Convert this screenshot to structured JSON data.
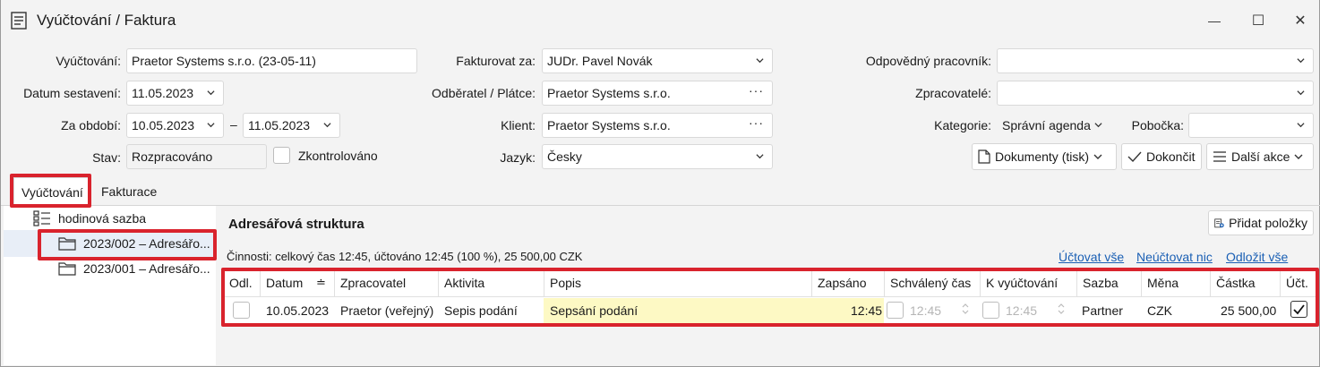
{
  "window": {
    "title": "Vyúčtování / Faktura",
    "minimize_glyph": "—",
    "maximize_glyph": "☐",
    "close_glyph": "✕"
  },
  "form": {
    "vyuctovani": {
      "label": "Vyúčtování:",
      "value": "Praetor Systems s.r.o. (23-05-11)"
    },
    "datum_sestaveni": {
      "label": "Datum sestavení:",
      "value": "11.05.2023"
    },
    "za_obdobi": {
      "label": "Za období:",
      "from": "10.05.2023",
      "dash": "–",
      "to": "11.05.2023"
    },
    "stav": {
      "label": "Stav:",
      "value": "Rozpracováno"
    },
    "zkontrolovano": {
      "label": "Zkontrolováno",
      "checked": false
    },
    "fakturovat_za": {
      "label": "Fakturovat za:",
      "value": "JUDr. Pavel Novák"
    },
    "odberatel": {
      "label": "Odběratel / Plátce:",
      "value": "Praetor Systems s.r.o.",
      "dots": "···"
    },
    "klient": {
      "label": "Klient:",
      "value": "Praetor Systems s.r.o.",
      "dots": "···"
    },
    "jazyk": {
      "label": "Jazyk:",
      "value": "Česky"
    },
    "odpovedny": {
      "label": "Odpovědný pracovník:",
      "value": ""
    },
    "zpracovatele": {
      "label": "Zpracovatelé:",
      "value": ""
    },
    "kategorie": {
      "label": "Kategorie:",
      "value": "Správní agenda"
    },
    "pobocka": {
      "label": "Pobočka:",
      "value": ""
    }
  },
  "buttons": {
    "dokumenty": "Dokumenty (tisk)",
    "dokoncit": "Dokončit",
    "dalsi_akce": "Další akce",
    "pridat_polozky": "Přidat položky"
  },
  "tabs": [
    {
      "label": "Vyúčtování",
      "active": true
    },
    {
      "label": "Fakturace",
      "active": false
    }
  ],
  "tree": {
    "root": "hodinová sazba",
    "items": [
      {
        "label": "2023/002 – Adresářo...",
        "selected": true
      },
      {
        "label": "2023/001 – Adresářo...",
        "selected": false
      }
    ]
  },
  "main": {
    "heading": "Adresářová struktura",
    "summary": "Činnosti: celkový čas 12:45, účtováno 12:45 (100 %), 25 500,00 CZK",
    "links": [
      "Účtovat vše",
      "Neúčtovat nic",
      "Odložit vše"
    ]
  },
  "grid": {
    "columns": [
      "Odl.",
      "Datum",
      "Zpracovatel",
      "Aktivita",
      "Popis",
      "Zapsáno",
      "Schválený čas",
      "K vyúčtování",
      "Sazba",
      "Měna",
      "Částka",
      "Účt."
    ],
    "sort_glyph": "≐",
    "rows": [
      {
        "odl": false,
        "datum": "10.05.2023",
        "zpracovatel": "Praetor (veřejný)",
        "aktivita": "Sepis podání",
        "popis": "Sepsání podání",
        "zapsano": "12:45",
        "schvaleny_cas": "12:45",
        "k_vyuctovani": "12:45",
        "sazba": "Partner",
        "mena": "CZK",
        "castka": "25 500,00",
        "uct": true
      }
    ]
  },
  "colors": {
    "highlight_red": "#d9232d",
    "popis_yellow": "#fdf9c4",
    "link_blue": "#1a5fb4"
  }
}
